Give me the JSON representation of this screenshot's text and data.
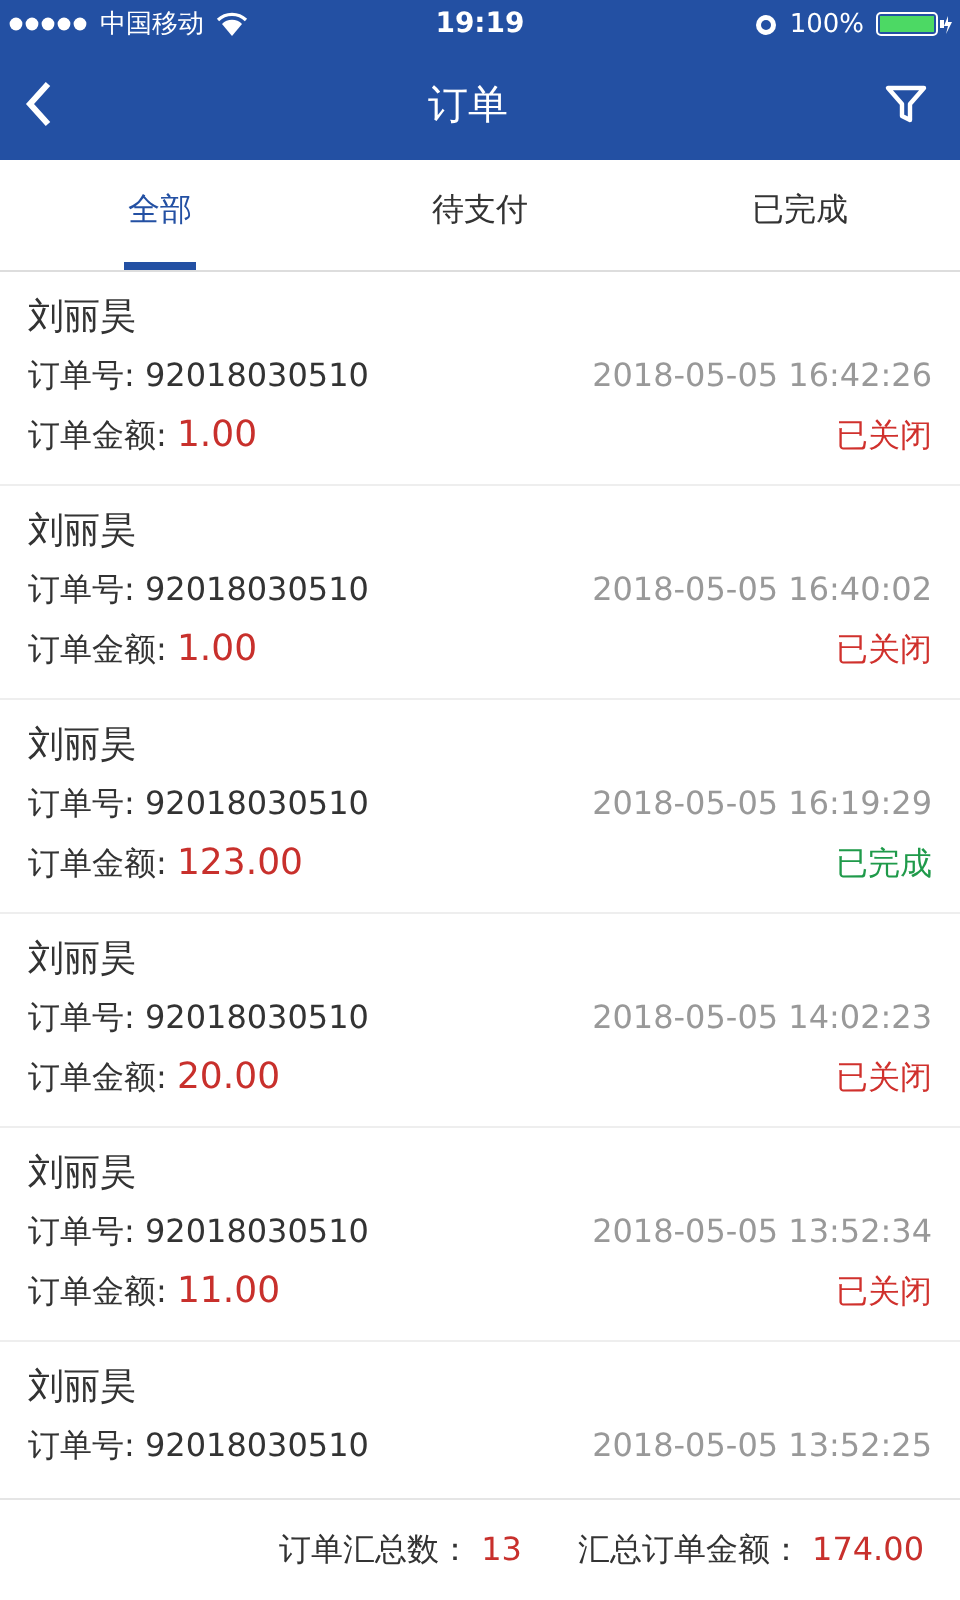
{
  "status_bar": {
    "carrier": "中国移动",
    "time": "19:19",
    "battery": "100%"
  },
  "nav": {
    "title": "订单"
  },
  "tabs": [
    {
      "label": "全部",
      "selected": true
    },
    {
      "label": "待支付",
      "selected": false
    },
    {
      "label": "已完成",
      "selected": false
    }
  ],
  "orders": [
    {
      "name": "刘丽昊",
      "order_label": "订单号:",
      "order_no": "92018030510",
      "time": "2018-05-05 16:42:26",
      "amount_label": "订单金额:",
      "amount": "1.00",
      "status": "已关闭",
      "kind": "closed"
    },
    {
      "name": "刘丽昊",
      "order_label": "订单号:",
      "order_no": "92018030510",
      "time": "2018-05-05 16:40:02",
      "amount_label": "订单金额:",
      "amount": "1.00",
      "status": "已关闭",
      "kind": "closed"
    },
    {
      "name": "刘丽昊",
      "order_label": "订单号:",
      "order_no": "92018030510",
      "time": "2018-05-05 16:19:29",
      "amount_label": "订单金额:",
      "amount": "123.00",
      "status": "已完成",
      "kind": "completed"
    },
    {
      "name": "刘丽昊",
      "order_label": "订单号:",
      "order_no": "92018030510",
      "time": "2018-05-05 14:02:23",
      "amount_label": "订单金额:",
      "amount": "20.00",
      "status": "已关闭",
      "kind": "closed"
    },
    {
      "name": "刘丽昊",
      "order_label": "订单号:",
      "order_no": "92018030510",
      "time": "2018-05-05 13:52:34",
      "amount_label": "订单金额:",
      "amount": "11.00",
      "status": "已关闭",
      "kind": "closed"
    },
    {
      "name": "刘丽昊",
      "order_label": "订单号:",
      "order_no": "92018030510",
      "time": "2018-05-05 13:52:25"
    }
  ],
  "footer": {
    "count_label": "订单汇总数：",
    "count": "13",
    "total_label": "汇总订单金额：",
    "total": "174.00"
  }
}
